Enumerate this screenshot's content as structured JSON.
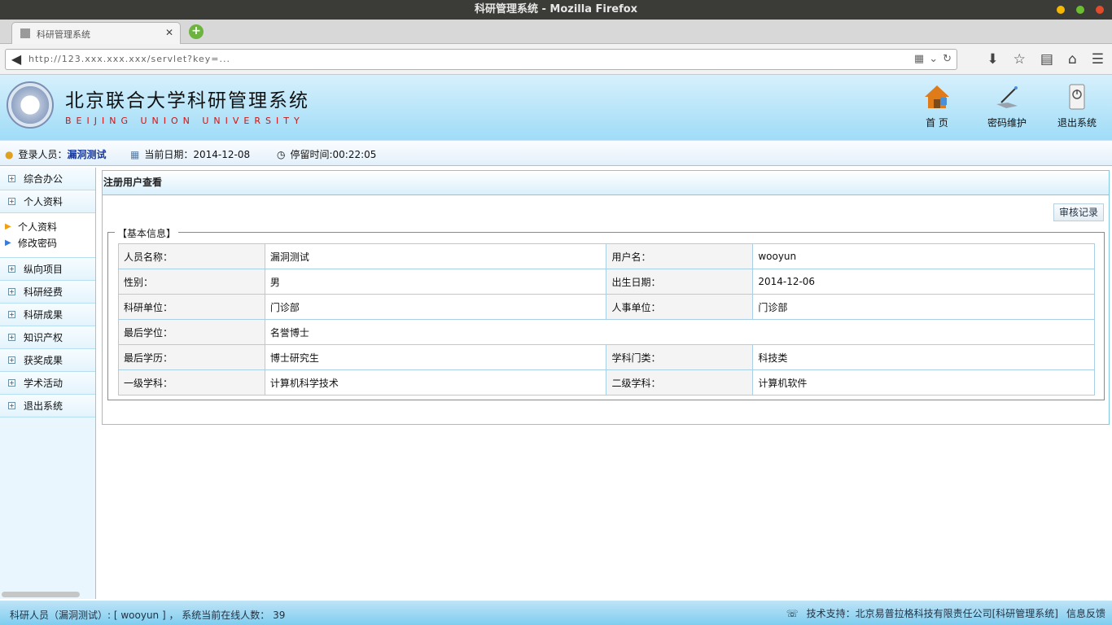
{
  "browser": {
    "window_title": "科研管理系统 - Mozilla Firefox",
    "tab_title": "科研管理系统",
    "url": "http://123.xxx.xxx.xxx/servlet?key=..."
  },
  "banner": {
    "title": "北京联合大学科研管理系统",
    "subtitle": "BEIJING UNION UNIVERSITY",
    "actions": [
      {
        "label": "首 页",
        "icon": "home-icon"
      },
      {
        "label": "密码维护",
        "icon": "password-pen-icon"
      },
      {
        "label": "退出系统",
        "icon": "power-exit-icon"
      }
    ]
  },
  "infobar": {
    "user_label": "登录人员：",
    "user_value": "漏洞测试",
    "date_label": "当前日期：",
    "date_value": "2014-12-08",
    "stay_label": "停留时间:",
    "stay_value": "00:22:05"
  },
  "sidebar": {
    "items": [
      {
        "label": "综合办公"
      },
      {
        "label": "个人资料"
      }
    ],
    "subitems": [
      {
        "label": "个人资料"
      },
      {
        "label": "修改密码"
      }
    ],
    "items_after": [
      {
        "label": "纵向项目"
      },
      {
        "label": "科研经费"
      },
      {
        "label": "科研成果"
      },
      {
        "label": "知识产权"
      },
      {
        "label": "获奖成果"
      },
      {
        "label": "学术活动"
      },
      {
        "label": "退出系统"
      }
    ]
  },
  "content": {
    "panel_title": "注册用户查看",
    "audit_button": "审核记录",
    "legend": "【基本信息】",
    "rows": [
      [
        "人员名称：",
        "漏洞测试",
        "用户名：",
        "wooyun"
      ],
      [
        "性别：",
        "男",
        "出生日期：",
        "2014-12-06"
      ],
      [
        "科研单位：",
        "门诊部",
        "人事单位：",
        "门诊部"
      ],
      [
        "最后学位：",
        "名誉博士",
        "",
        ""
      ],
      [
        "最后学历：",
        "博士研究生",
        "学科门类：",
        "科技类"
      ],
      [
        "一级学科：",
        "计算机科学技术",
        "二级学科：",
        "计算机软件"
      ]
    ]
  },
  "statusbar": {
    "left": "科研人员（漏洞测试）: [ wooyun ]  ，  系统当前在线人数：  39",
    "support": "技术支持：北京易普拉格科技有限责任公司[科研管理系统]",
    "feedback": "信息反馈"
  }
}
